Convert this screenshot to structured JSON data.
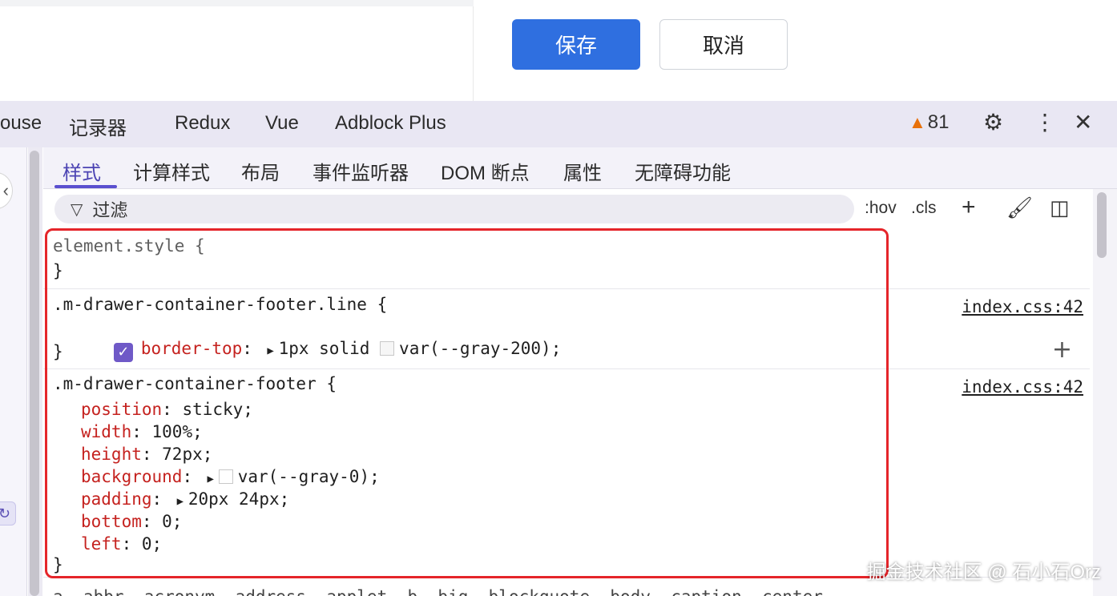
{
  "page": {
    "save_label": "保存",
    "cancel_label": "取消"
  },
  "devtools": {
    "main_tabs": [
      "ouse",
      "记录器",
      "Redux",
      "Vue",
      "Adblock Plus"
    ],
    "warning_count": "81",
    "icons": {
      "warning": "warning-icon",
      "settings": "gear-icon",
      "more": "more-vertical-icon",
      "close": "close-icon"
    }
  },
  "sub_tabs": [
    "样式",
    "计算样式",
    "布局",
    "事件监听器",
    "DOM 断点",
    "属性",
    "无障碍功能"
  ],
  "filter": {
    "placeholder": "过滤",
    "hov": ":hov",
    "cls": ".cls"
  },
  "rules": [
    {
      "selector": "element.style {",
      "close": "}"
    },
    {
      "selector": ".m-drawer-container-footer.line {",
      "source": "index.css:42",
      "decls": [
        {
          "name": "border-top",
          "value": "1px solid",
          "var": "var(--gray-200);"
        }
      ],
      "close": "}"
    },
    {
      "selector": ".m-drawer-container-footer {",
      "source": "index.css:42",
      "decls": [
        {
          "name": "position",
          "value": "sticky;"
        },
        {
          "name": "width",
          "value": "100%;"
        },
        {
          "name": "height",
          "value": "72px;"
        },
        {
          "name": "background",
          "value": "var(--gray-0);"
        },
        {
          "name": "padding",
          "value": "20px 24px;"
        },
        {
          "name": "bottom",
          "value": "0;"
        },
        {
          "name": "left",
          "value": "0;"
        }
      ],
      "close": "}"
    }
  ],
  "next_rule_partial": "a, abbr, acronym, address, applet, b, big, blockquote, body, caption, center,",
  "watermark": "掘金技术社区 @ 石小石Orz",
  "colors": {
    "accent": "#5a4fcf",
    "save": "#2f6fe0",
    "property": "#c5221f",
    "highlight": "#e5252a"
  }
}
